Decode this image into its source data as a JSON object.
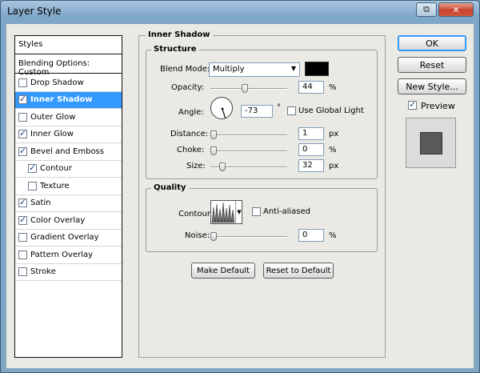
{
  "window": {
    "title": "Layer Style",
    "restore_glyph": "⧉",
    "close_glyph": "✕"
  },
  "styles_list": {
    "header": "Styles",
    "blending": "Blending Options: Custom",
    "items": [
      {
        "label": "Drop Shadow",
        "checked": false,
        "indent": false,
        "selected": false
      },
      {
        "label": "Inner Shadow",
        "checked": true,
        "indent": false,
        "selected": true
      },
      {
        "label": "Outer Glow",
        "checked": false,
        "indent": false,
        "selected": false
      },
      {
        "label": "Inner Glow",
        "checked": true,
        "indent": false,
        "selected": false
      },
      {
        "label": "Bevel and Emboss",
        "checked": true,
        "indent": false,
        "selected": false
      },
      {
        "label": "Contour",
        "checked": true,
        "indent": true,
        "selected": false
      },
      {
        "label": "Texture",
        "checked": false,
        "indent": true,
        "selected": false
      },
      {
        "label": "Satin",
        "checked": true,
        "indent": false,
        "selected": false
      },
      {
        "label": "Color Overlay",
        "checked": true,
        "indent": false,
        "selected": false
      },
      {
        "label": "Gradient Overlay",
        "checked": false,
        "indent": false,
        "selected": false
      },
      {
        "label": "Pattern Overlay",
        "checked": false,
        "indent": false,
        "selected": false
      },
      {
        "label": "Stroke",
        "checked": false,
        "indent": false,
        "selected": false
      }
    ]
  },
  "inner_shadow": {
    "section_title": "Inner Shadow",
    "structure": {
      "title": "Structure",
      "blend_mode_label": "Blend Mode:",
      "blend_mode_value": "Multiply",
      "color": "#000000",
      "opacity_label": "Opacity:",
      "opacity_value": "44",
      "opacity_unit": "%",
      "opacity_fraction": 0.44,
      "angle_label": "Angle:",
      "angle_value": "-73",
      "angle_unit": "°",
      "use_global_light_label": "Use Global Light",
      "use_global_light": false,
      "distance_label": "Distance:",
      "distance_value": "1",
      "distance_unit": "px",
      "distance_fraction": 0.0,
      "choke_label": "Choke:",
      "choke_value": "0",
      "choke_unit": "%",
      "choke_fraction": 0.0,
      "size_label": "Size:",
      "size_value": "32",
      "size_unit": "px",
      "size_fraction": 0.13
    },
    "quality": {
      "title": "Quality",
      "contour_label": "Contour:",
      "anti_aliased_label": "Anti-aliased",
      "anti_aliased": false,
      "noise_label": "Noise:",
      "noise_value": "0",
      "noise_unit": "%",
      "noise_fraction": 0.0
    },
    "make_default_label": "Make Default",
    "reset_default_label": "Reset to Default"
  },
  "buttons": {
    "ok_label": "OK",
    "reset_label": "Reset",
    "new_style_label": "New Style...",
    "preview_label": "Preview",
    "preview_checked": true
  },
  "colors": {
    "selected": "#3399ff",
    "preview_inner": "#595959",
    "preview_outer": "#dcdcdc"
  }
}
